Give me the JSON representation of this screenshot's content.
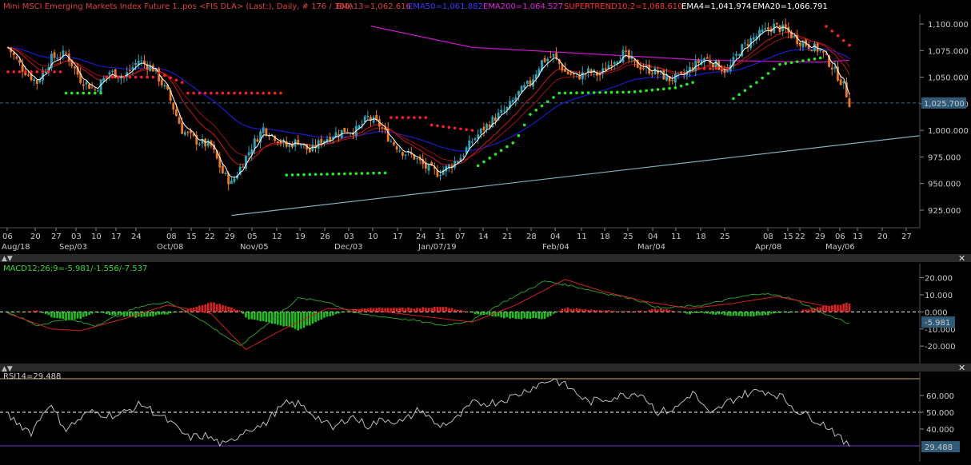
{
  "header": {
    "instrument": "Mini MSCI Emerging Markets Index Future 1..pos <FIS DLA> (Last:), Daily, # 176 / 300,",
    "ema13": "EMA13=1,062.616",
    "ema50": "EMA50=1,061.882",
    "ema200": "EMA200=1,064.527",
    "supertrend": "SUPERTREND10;2=1,068.610",
    "ema4": "EMA4=1,041.974",
    "ema20": "EMA20=1,066.791"
  },
  "price_panel": {
    "y_ticks": [
      "1,100.000",
      "1,075.000",
      "1,050.000",
      "1,025.000",
      "1,000.000",
      "975.000",
      "950.000",
      "925.000"
    ],
    "last_price": "1,025.700",
    "x_day_ticks": [
      "06",
      "20",
      "27",
      "03",
      "10",
      "17",
      "24",
      "08",
      "15",
      "22",
      "29",
      "05",
      "12",
      "19",
      "26",
      "03",
      "10",
      "17",
      "24",
      "31",
      "07",
      "14",
      "21",
      "28",
      "04",
      "11",
      "18",
      "25",
      "04",
      "11",
      "18",
      "25",
      "08",
      "15",
      "22",
      "29",
      "06",
      "13",
      "20",
      "27"
    ],
    "x_month_ticks": [
      "Aug/18",
      "Sep/03",
      "Oct/08",
      "Nov/05",
      "Dec/03",
      "Jan/07/19",
      "Feb/04",
      "Mar/04",
      "Apr/08",
      "May/06"
    ]
  },
  "macd_panel": {
    "title": "MACD12;26;9=-5.981/-1.556/-7.537",
    "y_ticks": [
      "20.000",
      "10.000",
      "0.000",
      "-10.000",
      "-20.000"
    ],
    "last_value": "-5.981"
  },
  "rsi_panel": {
    "title": "RSI14=29.488",
    "y_ticks": [
      "60.000",
      "50.000",
      "40.000"
    ],
    "last_value": "29.488"
  },
  "colors": {
    "background": "#000000",
    "up_candle": "#2aa6b8",
    "down_candle": "#f07a1e",
    "ema4": "#ffffff",
    "ema13": "#d01818",
    "ema50": "#1b1bd0",
    "ema200": "#d014d0",
    "supertrend_up": "#22ee22",
    "supertrend_down": "#ff2020",
    "trendline": "#7fb0c0"
  },
  "chart_data": [
    {
      "type": "candlestick",
      "title": "Mini MSCI Emerging Markets Index Future 1..pos <FIS DLA> (Last:), Daily",
      "ylim": [
        915,
        1105
      ],
      "close_waypoints": [
        [
          0,
          1078
        ],
        [
          5,
          1058
        ],
        [
          10,
          1045
        ],
        [
          15,
          1068
        ],
        [
          20,
          1072
        ],
        [
          25,
          1048
        ],
        [
          30,
          1038
        ],
        [
          35,
          1055
        ],
        [
          40,
          1050
        ],
        [
          45,
          1066
        ],
        [
          50,
          1058
        ],
        [
          55,
          1035
        ],
        [
          60,
          1000
        ],
        [
          65,
          990
        ],
        [
          70,
          985
        ],
        [
          74,
          960
        ],
        [
          77,
          950
        ],
        [
          80,
          965
        ],
        [
          84,
          985
        ],
        [
          88,
          1002
        ],
        [
          92,
          994
        ],
        [
          96,
          985
        ],
        [
          100,
          990
        ],
        [
          104,
          980
        ],
        [
          108,
          990
        ],
        [
          112,
          996
        ],
        [
          116,
          1000
        ],
        [
          120,
          1000
        ],
        [
          124,
          1012
        ],
        [
          128,
          1005
        ],
        [
          132,
          990
        ],
        [
          136,
          980
        ],
        [
          140,
          975
        ],
        [
          144,
          965
        ],
        [
          148,
          960
        ],
        [
          152,
          966
        ],
        [
          156,
          975
        ],
        [
          160,
          990
        ],
        [
          164,
          1002
        ],
        [
          168,
          1012
        ],
        [
          172,
          1020
        ],
        [
          176,
          1035
        ],
        [
          180,
          1045
        ],
        [
          184,
          1065
        ],
        [
          188,
          1070
        ],
        [
          192,
          1055
        ],
        [
          196,
          1050
        ],
        [
          200,
          1055
        ],
        [
          204,
          1052
        ],
        [
          208,
          1065
        ],
        [
          212,
          1072
        ],
        [
          216,
          1062
        ],
        [
          220,
          1058
        ],
        [
          224,
          1054
        ],
        [
          228,
          1048
        ],
        [
          232,
          1050
        ],
        [
          236,
          1060
        ],
        [
          240,
          1068
        ],
        [
          244,
          1062
        ],
        [
          248,
          1055
        ],
        [
          252,
          1075
        ],
        [
          256,
          1085
        ],
        [
          260,
          1092
        ],
        [
          264,
          1098
        ],
        [
          268,
          1094
        ],
        [
          272,
          1085
        ],
        [
          276,
          1080
        ],
        [
          280,
          1075
        ],
        [
          284,
          1060
        ],
        [
          288,
          1042
        ],
        [
          290,
          1026
        ]
      ],
      "supertrend_waypoints": [
        [
          0,
          1055,
          "d"
        ],
        [
          18,
          1055,
          "d"
        ],
        [
          19,
          1035,
          "u"
        ],
        [
          32,
          1035,
          "u"
        ],
        [
          33,
          1050,
          "d"
        ],
        [
          50,
          1050,
          "d"
        ],
        [
          51,
          1055,
          "d"
        ],
        [
          60,
          1045,
          "d"
        ],
        [
          61,
          1035,
          "d"
        ],
        [
          95,
          1035,
          "d"
        ],
        [
          96,
          958,
          "u"
        ],
        [
          130,
          960,
          "u"
        ],
        [
          131,
          1012,
          "d"
        ],
        [
          145,
          1012,
          "d"
        ],
        [
          146,
          1005,
          "d"
        ],
        [
          160,
          1000,
          "d"
        ],
        [
          161,
          965,
          "u"
        ],
        [
          175,
          990,
          "u"
        ],
        [
          180,
          1015,
          "u"
        ],
        [
          190,
          1035,
          "u"
        ],
        [
          215,
          1036,
          "u"
        ],
        [
          230,
          1040,
          "u"
        ],
        [
          236,
          1045,
          "u"
        ],
        [
          237,
          1058,
          "d"
        ],
        [
          248,
          1058,
          "d"
        ],
        [
          249,
          1028,
          "u"
        ],
        [
          258,
          1045,
          "u"
        ],
        [
          266,
          1062,
          "u"
        ],
        [
          280,
          1068,
          "u"
        ],
        [
          281,
          1100,
          "d"
        ],
        [
          290,
          1080,
          "d"
        ]
      ],
      "ema200_waypoints": [
        [
          125,
          1098
        ],
        [
          160,
          1078
        ],
        [
          200,
          1072
        ],
        [
          240,
          1066
        ],
        [
          280,
          1064
        ],
        [
          290,
          1066
        ]
      ],
      "trendline": [
        [
          77,
          920
        ],
        [
          300,
          995
        ]
      ],
      "last_price": 1025.7
    },
    {
      "type": "macd",
      "title": "MACD12;26;9",
      "ylim": [
        -26,
        24
      ],
      "macd_waypoints": [
        [
          0,
          0
        ],
        [
          10,
          -8
        ],
        [
          20,
          -4
        ],
        [
          30,
          -8
        ],
        [
          45,
          3
        ],
        [
          55,
          6
        ],
        [
          65,
          -3
        ],
        [
          80,
          -20
        ],
        [
          90,
          -6
        ],
        [
          100,
          8
        ],
        [
          110,
          6
        ],
        [
          120,
          -1
        ],
        [
          140,
          -5
        ],
        [
          150,
          -8
        ],
        [
          160,
          -5
        ],
        [
          170,
          5
        ],
        [
          185,
          18
        ],
        [
          195,
          15
        ],
        [
          205,
          11
        ],
        [
          215,
          8
        ],
        [
          225,
          2
        ],
        [
          240,
          4
        ],
        [
          250,
          8
        ],
        [
          260,
          11
        ],
        [
          270,
          8
        ],
        [
          280,
          0
        ],
        [
          290,
          -7
        ]
      ],
      "signal_waypoints": [
        [
          0,
          -1
        ],
        [
          15,
          -10
        ],
        [
          25,
          -11
        ],
        [
          40,
          -4
        ],
        [
          55,
          4
        ],
        [
          70,
          -1
        ],
        [
          82,
          -22
        ],
        [
          95,
          -10
        ],
        [
          110,
          2
        ],
        [
          125,
          1
        ],
        [
          145,
          -3
        ],
        [
          160,
          -6
        ],
        [
          175,
          4
        ],
        [
          192,
          19
        ],
        [
          205,
          12
        ],
        [
          220,
          6
        ],
        [
          235,
          2
        ],
        [
          250,
          5
        ],
        [
          265,
          9
        ],
        [
          280,
          4
        ],
        [
          290,
          0
        ]
      ]
    },
    {
      "type": "rsi",
      "title": "RSI14",
      "ylim": [
        25,
        75
      ],
      "rsi_waypoints": [
        [
          0,
          48
        ],
        [
          8,
          38
        ],
        [
          14,
          55
        ],
        [
          20,
          40
        ],
        [
          28,
          50
        ],
        [
          38,
          48
        ],
        [
          46,
          55
        ],
        [
          55,
          45
        ],
        [
          62,
          35
        ],
        [
          68,
          36
        ],
        [
          75,
          30
        ],
        [
          82,
          40
        ],
        [
          88,
          42
        ],
        [
          92,
          50
        ],
        [
          96,
          55
        ],
        [
          100,
          55
        ],
        [
          106,
          48
        ],
        [
          112,
          40
        ],
        [
          118,
          48
        ],
        [
          124,
          42
        ],
        [
          130,
          46
        ],
        [
          136,
          44
        ],
        [
          142,
          52
        ],
        [
          148,
          42
        ],
        [
          154,
          45
        ],
        [
          160,
          55
        ],
        [
          168,
          56
        ],
        [
          175,
          60
        ],
        [
          182,
          66
        ],
        [
          188,
          70
        ],
        [
          194,
          64
        ],
        [
          200,
          56
        ],
        [
          206,
          58
        ],
        [
          212,
          60
        ],
        [
          218,
          62
        ],
        [
          224,
          50
        ],
        [
          230,
          52
        ],
        [
          236,
          62
        ],
        [
          242,
          48
        ],
        [
          248,
          56
        ],
        [
          254,
          61
        ],
        [
          260,
          63
        ],
        [
          266,
          60
        ],
        [
          272,
          51
        ],
        [
          278,
          46
        ],
        [
          284,
          40
        ],
        [
          288,
          32
        ],
        [
          290,
          29.5
        ]
      ]
    }
  ]
}
